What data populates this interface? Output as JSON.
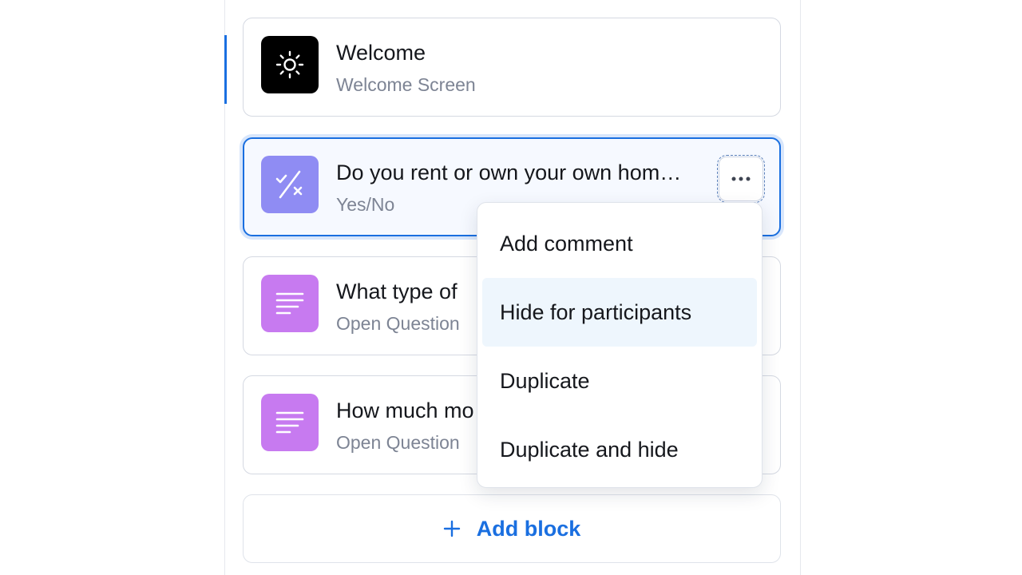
{
  "blocks": [
    {
      "title": "Welcome",
      "subtitle": "Welcome Screen",
      "icon": "sun-icon"
    },
    {
      "title": "Do you rent or own your own hom…",
      "subtitle": "Yes/No",
      "icon": "yes-no-icon"
    },
    {
      "title": "What type of",
      "subtitle": "Open Question",
      "icon": "text-lines-icon"
    },
    {
      "title": "How much mo",
      "subtitle": "Open Question",
      "icon": "text-lines-icon"
    }
  ],
  "menu": {
    "items": [
      "Add comment",
      "Hide for participants",
      "Duplicate",
      "Duplicate and hide"
    ],
    "highlighted_index": 1
  },
  "add_block": {
    "label": "Add block",
    "icon": "plus-icon"
  },
  "more_button": {
    "icon": "more-horizontal-icon"
  },
  "colors": {
    "accent": "#1a6fe0",
    "welcome_icon_bg": "#000000",
    "yesno_icon_bg": "#8f8cf3",
    "open_icon_bg": "#c77af0",
    "menu_highlight": "#eef6fd"
  }
}
